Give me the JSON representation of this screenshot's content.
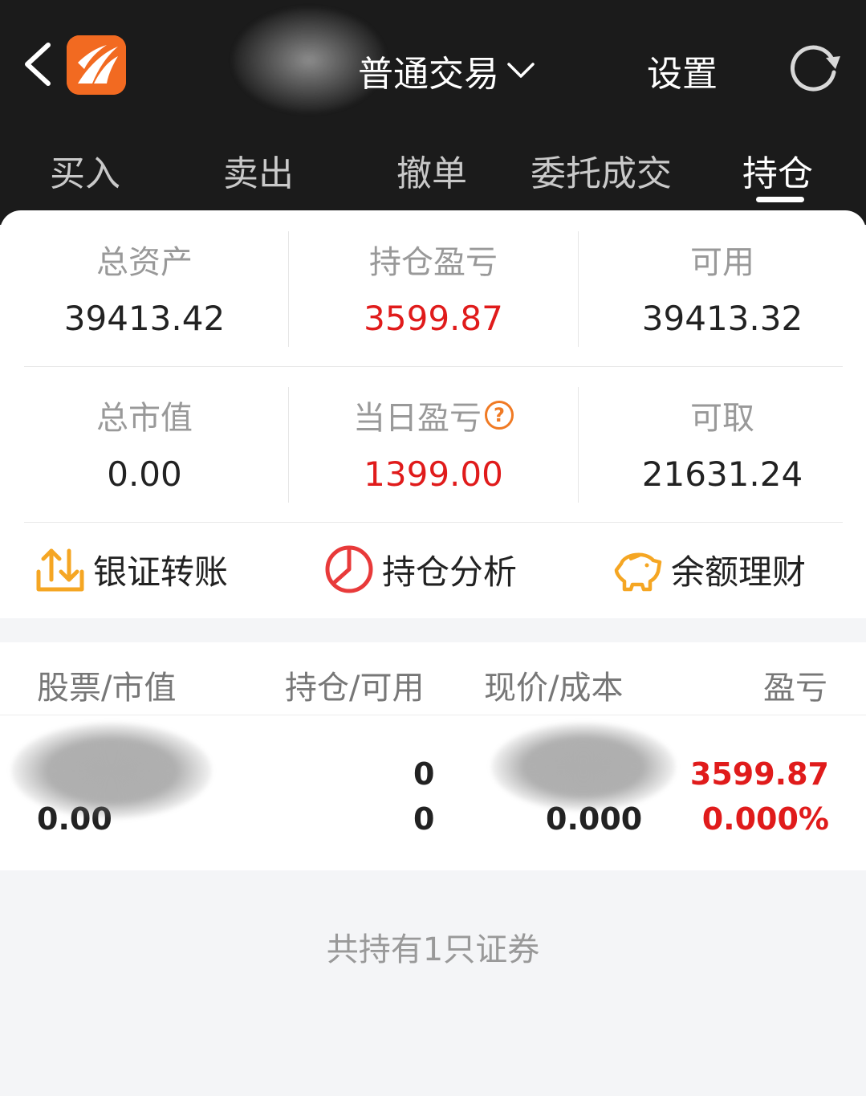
{
  "header": {
    "title": "普通交易",
    "settings_label": "设置"
  },
  "tabs": [
    {
      "label": "买入"
    },
    {
      "label": "卖出"
    },
    {
      "label": "撤单"
    },
    {
      "label": "委托成交"
    },
    {
      "label": "持仓",
      "active": true
    }
  ],
  "summary": {
    "total_assets": {
      "label": "总资产",
      "value": "39413.42"
    },
    "position_pnl": {
      "label": "持仓盈亏",
      "value": "3599.87"
    },
    "available": {
      "label": "可用",
      "value": "39413.32"
    },
    "market_value": {
      "label": "总市值",
      "value": "0.00"
    },
    "daily_pnl": {
      "label": "当日盈亏",
      "value": "1399.00",
      "help_icon": "?"
    },
    "withdrawable": {
      "label": "可取",
      "value": "21631.24"
    }
  },
  "actions": [
    {
      "label": "银证转账",
      "icon": "transfer-icon"
    },
    {
      "label": "持仓分析",
      "icon": "pie-chart-icon"
    },
    {
      "label": "余额理财",
      "icon": "piggy-bank-icon"
    }
  ],
  "table": {
    "headers": [
      "股票/市值",
      "持仓/可用",
      "现价/成本",
      "盈亏"
    ],
    "rows": [
      {
        "market_value": "0.00",
        "position": "0",
        "available": "0",
        "cost": "0.000",
        "pnl": "3599.87",
        "pnl_pct": "0.000%"
      }
    ]
  },
  "footer": {
    "text": "共持有1只证券"
  },
  "colors": {
    "header_bg": "#1b1b1b",
    "accent_orange": "#f26a21",
    "profit_red": "#e01b1b",
    "muted_text": "#999999"
  }
}
